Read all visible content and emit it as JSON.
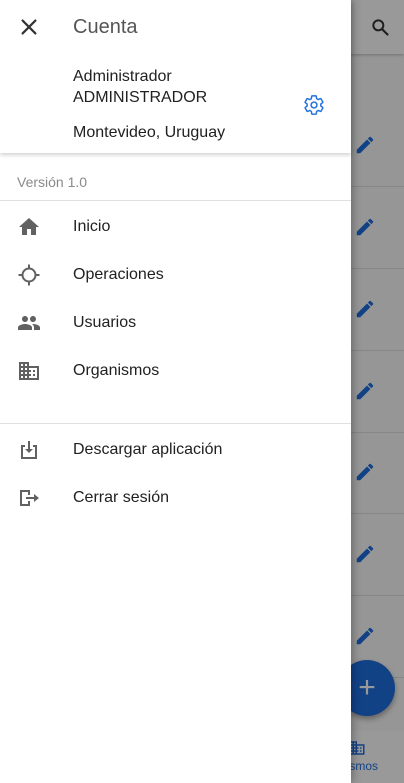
{
  "drawer": {
    "title": "Cuenta",
    "user": {
      "name": "Administrador",
      "role": "ADMINISTRADOR",
      "location": "Montevideo, Uruguay"
    },
    "version": "Versión 1.0",
    "nav_items": [
      {
        "label": "Inicio",
        "icon": "home-icon"
      },
      {
        "label": "Operaciones",
        "icon": "crosshair-icon"
      },
      {
        "label": "Usuarios",
        "icon": "people-icon"
      },
      {
        "label": "Organismos",
        "icon": "building-icon"
      }
    ],
    "secondary_items": [
      {
        "label": "Descargar aplicación",
        "icon": "download-icon"
      },
      {
        "label": "Cerrar sesión",
        "icon": "logout-icon"
      }
    ]
  },
  "background": {
    "bottom_nav_label": "nismos"
  },
  "colors": {
    "accent": "#1e6fe0",
    "icon_gray": "#616161",
    "text": "#212121",
    "muted": "#8a8a8a"
  }
}
